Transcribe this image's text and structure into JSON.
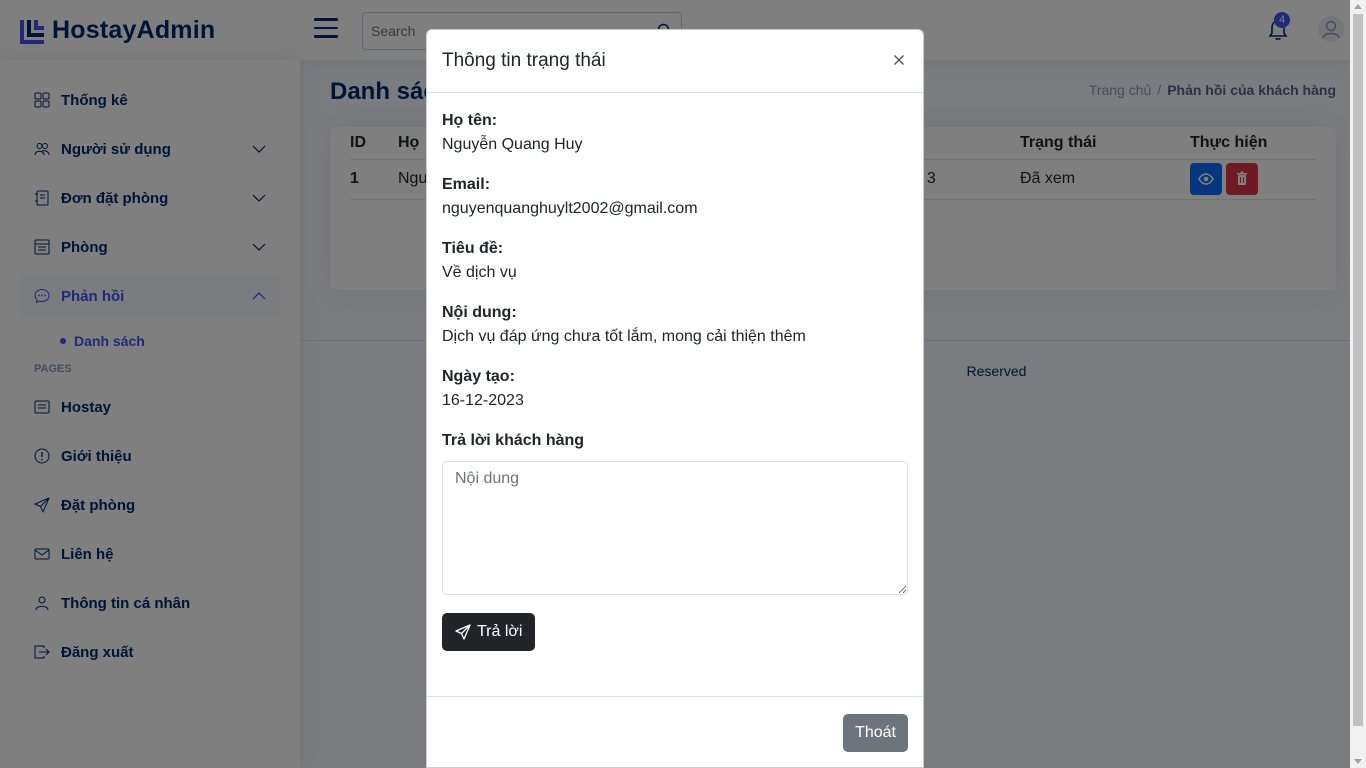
{
  "app": {
    "logo_text": "HostayAdmin"
  },
  "header": {
    "search": {
      "placeholder": "Search"
    },
    "notifications": {
      "count": "4"
    }
  },
  "sidebar": {
    "items": [
      {
        "label": "Thống kê",
        "icon": "grid-icon"
      },
      {
        "label": "Người sử dụng",
        "icon": "people-icon"
      },
      {
        "label": "Đơn đặt phòng",
        "icon": "journal-icon"
      },
      {
        "label": "Phòng",
        "icon": "layout-text-window-icon"
      },
      {
        "label": "Phản hồi",
        "icon": "chat-dots-icon"
      }
    ],
    "sub_items": [
      {
        "label": "Danh sách"
      }
    ],
    "pages_heading": "PAGES",
    "pages": [
      {
        "label": "Hostay",
        "icon": "card-list-icon"
      },
      {
        "label": "Giới thiệu",
        "icon": "exclamation-circle-icon"
      },
      {
        "label": "Đặt phòng",
        "icon": "send-icon"
      },
      {
        "label": "Liên hệ",
        "icon": "envelope-icon"
      },
      {
        "label": "Thông tin cá nhân",
        "icon": "person-icon"
      },
      {
        "label": "Đăng xuất",
        "icon": "box-arrow-right-icon"
      }
    ]
  },
  "main": {
    "page_title": "Danh sách",
    "breadcrumb": {
      "home": "Trang chủ",
      "separator": "/",
      "current": "Phản hồi của khách hàng"
    },
    "table": {
      "headers": [
        "ID",
        "Họ",
        "Trạng thái",
        "Thực hiện"
      ],
      "rows": [
        {
          "id": "1",
          "name_fragment": "Ngu",
          "date_fragment": "3",
          "status": "Đã xem"
        }
      ]
    },
    "footer_fragment": "Reserved"
  },
  "modal": {
    "title": "Thông tin trạng thái",
    "fields": [
      {
        "label": "Họ tên:",
        "value": "Nguyễn Quang Huy"
      },
      {
        "label": "Email:",
        "value": "nguyenquanghuylt2002@gmail.com"
      },
      {
        "label": "Tiêu đề:",
        "value": "Về dịch vụ"
      },
      {
        "label": "Nội dung:",
        "value": "Dịch vụ đáp ứng chưa tốt lắm, mong cải thiện thêm"
      },
      {
        "label": "Ngày tạo:",
        "value": "16-12-2023"
      }
    ],
    "reply_label": "Trả lời khách hàng",
    "reply_placeholder": "Nội dung",
    "reply_button": "Trả lời",
    "exit_button": "Thoát"
  },
  "colors": {
    "primary": "#012970",
    "accent": "#4154f1",
    "success": "#198754",
    "danger": "#dc3545",
    "info": "#0d6efd",
    "dark_button": "#212529",
    "secondary_button": "#6c757d"
  }
}
